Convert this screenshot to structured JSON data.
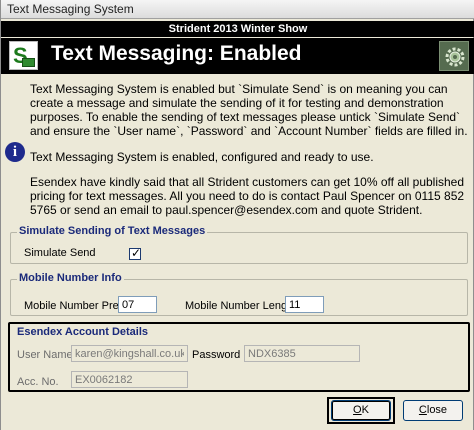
{
  "window": {
    "title": "Text Messaging System"
  },
  "showbar": {
    "text": "Strident 2013 Winter Show"
  },
  "header": {
    "title": "Text Messaging: Enabled",
    "icons": [
      "sms-app-icon",
      "gear-icon"
    ]
  },
  "messages": {
    "simulate_notice": "Text Messaging System is enabled but `Simulate Send` is on meaning you can create a message and simulate the sending of it for testing and demonstration purposes. To enable the sending of text messages please untick `Simulate Send` and ensure the `User name`, `Password` and `Account Number` fields are filled in.",
    "status": "Text Messaging System is enabled, configured and ready to use.",
    "promo": "Esendex have kindly said that all Strident customers can get 10% off all published pricing for text messages. All you need to do is contact Paul Spencer on 0115 852 5765 or send an email to paul.spencer@esendex.com and quote Strident."
  },
  "simulate_group": {
    "legend": "Simulate Sending of Text Messages",
    "simulate_send_label": "Simulate Send",
    "simulate_send_checked": true
  },
  "mobile_group": {
    "legend": "Mobile Number Info",
    "prefix_label": "Mobile Number Prefix",
    "prefix_value": "07",
    "length_label": "Mobile Number Length",
    "length_value": "11"
  },
  "account_group": {
    "legend": "Esendex Account Details",
    "username_label": "User Name",
    "username_value": "karen@kingshall.co.uk",
    "password_label": "Password",
    "password_value": "NDX6385",
    "accno_label": "Acc. No.",
    "accno_value": "EX0062182"
  },
  "buttons": {
    "ok_underlined": "O",
    "ok_rest": "K",
    "close_underlined": "C",
    "close_rest": "lose"
  }
}
